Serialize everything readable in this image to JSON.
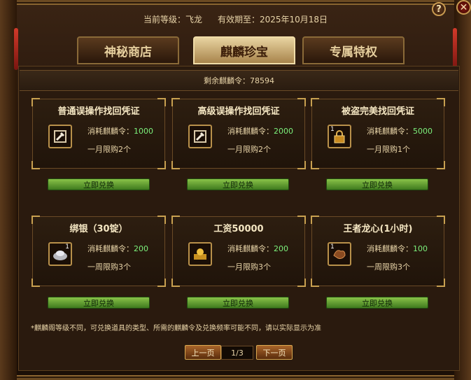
{
  "header": {
    "level_label": "当前等级：飞龙",
    "expiry_label": "有效期至：2025年10月18日"
  },
  "controls": {
    "help": "?",
    "close": "✕"
  },
  "tabs": [
    {
      "label": "神秘商店",
      "active": false
    },
    {
      "label": "麒麟珍宝",
      "active": true
    },
    {
      "label": "专属特权",
      "active": false
    }
  ],
  "balance": "剩余麒麟令：78594",
  "cost_prefix": "消耗麒麟令：",
  "redeem_label": "立即兑换",
  "items": [
    {
      "title": "普通误操作找回凭证",
      "cost": "1000",
      "limit": "一月限购2个",
      "icon": "wrench-icon"
    },
    {
      "title": "高级误操作找回凭证",
      "cost": "2000",
      "limit": "一月限购2个",
      "icon": "wrench-icon"
    },
    {
      "title": "被盗完美找回凭证",
      "cost": "5000",
      "limit": "一月限购1个",
      "icon": "lock-icon",
      "badge": "1"
    },
    {
      "title": "绑银（30锭）",
      "cost": "200",
      "limit": "一周限购3个",
      "icon": "silver-ingot-icon",
      "badge": "1"
    },
    {
      "title": "工资50000",
      "cost": "200",
      "limit": "一月限购3个",
      "icon": "gold-seal-icon"
    },
    {
      "title": "王者龙心(1小时)",
      "cost": "100",
      "limit": "一周限购3个",
      "icon": "dragon-heart-icon",
      "badge": "1"
    }
  ],
  "note": "*麒麟阁等级不同，可兑换道具的类型、所需的麒麟令及兑换频率可能不同，请以实际显示为准",
  "pager": {
    "prev": "上一页",
    "page": "1/3",
    "next": "下一页"
  },
  "colors": {
    "cost_number": "#7cf07c",
    "redeem_button": "#6aa838",
    "active_tab": "#d8bd84"
  }
}
